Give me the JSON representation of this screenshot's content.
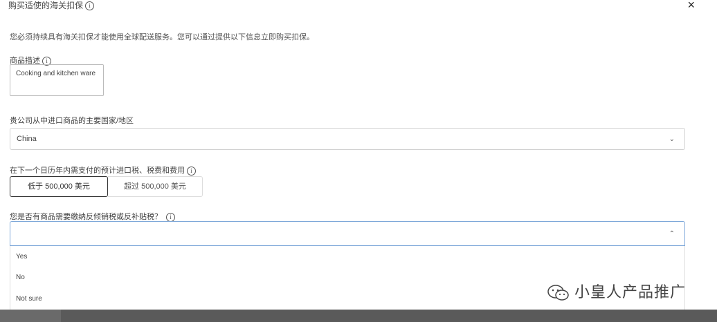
{
  "header": {
    "title": "购买适使的海关扣保",
    "close_glyph": "×"
  },
  "intro": "您必须持续具有海关扣保才能使用全球配送服务。您可以通过提供以下信息立即购买扣保。",
  "product_desc": {
    "label": "商品描述",
    "value": "Cooking and kitchen ware"
  },
  "country": {
    "label": "贵公司从中进口商品的主要国家/地区",
    "value": "China",
    "chevron": "⌄"
  },
  "amount": {
    "label": "在下一个日历年内需支付的预计进口税、税费和费用",
    "options": [
      "低于 500,000 美元",
      "超过 500,000 美元"
    ]
  },
  "duty": {
    "label": "您是否有商品需要缴纳反倾销税或反补贴税？",
    "chevron": "⌃",
    "options": [
      "Yes",
      "No",
      "Not sure"
    ]
  },
  "watermark": "小皇人产品推广"
}
